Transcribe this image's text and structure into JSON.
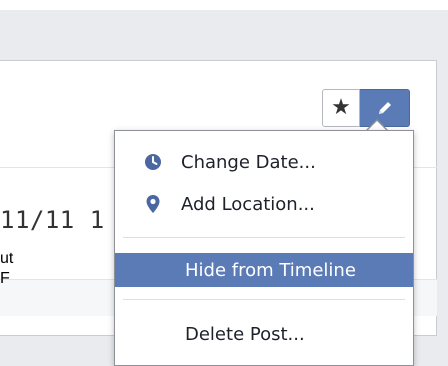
{
  "post": {
    "date_partial": "11/11 1",
    "body_line_1": "ut",
    "body_line_2": "F"
  },
  "toolbar": {
    "star_glyph": "★",
    "edit_icon": "pencil-icon"
  },
  "menu": {
    "items": [
      {
        "label": "Change Date...",
        "icon": "clock-icon"
      },
      {
        "label": "Add Location...",
        "icon": "map-pin-icon"
      },
      {
        "label": "Hide from Timeline",
        "highlighted": true
      },
      {
        "label": "Delete Post..."
      }
    ],
    "highlight_color": "#5b7bb7"
  },
  "colors": {
    "accent": "#5b7bb7",
    "page_bg": "#e9ebee"
  }
}
